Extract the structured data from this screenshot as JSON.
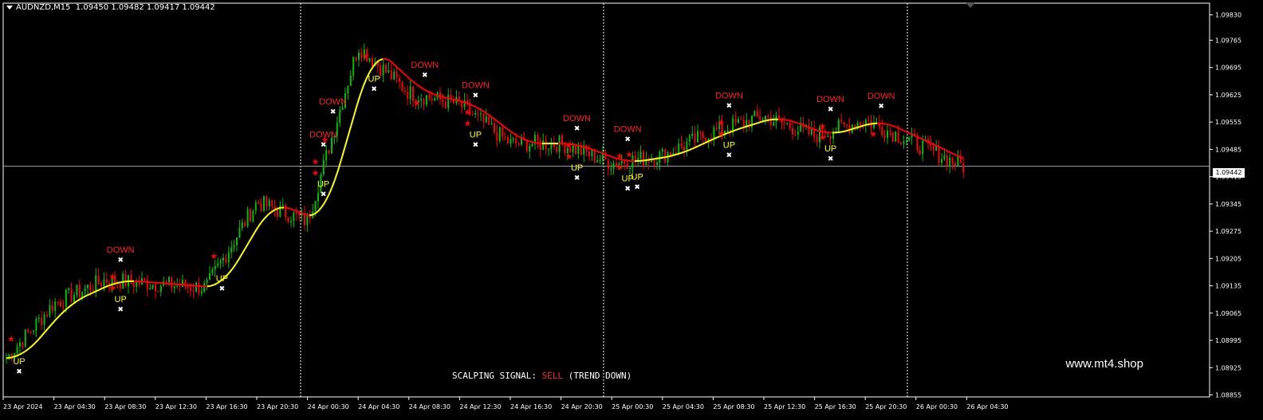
{
  "header": {
    "symbol_tf": "AUDNZD,M15",
    "ohlc": "1.09450 1.09482 1.09417 1.09442"
  },
  "watermark": "www.mt4.shop",
  "signal": {
    "prefix": "SCALPING SIGNAL: ",
    "value": "SELL",
    "suffix": " (TREND DOWN)",
    "value_color": "#ff2a2a"
  },
  "current_price": "1.09442",
  "colors": {
    "background": "#000000",
    "axis": "#ffffff",
    "bull_candle": "#00c000",
    "bear_candle": "#ff0000",
    "ma_up": "#ffff00",
    "ma_down": "#ff0000",
    "down_text": "#ff2020",
    "up_text": "#ffff00",
    "star": "#ff0000",
    "cross": "#ffffff"
  },
  "chart_data": {
    "type": "candlestick",
    "symbol": "AUDNZD",
    "timeframe": "M15",
    "y_ticks": [
      "1.09830",
      "1.09765",
      "1.09695",
      "1.09625",
      "1.09555",
      "1.09485",
      "1.09415",
      "1.09345",
      "1.09275",
      "1.09205",
      "1.09135",
      "1.09065",
      "1.08995",
      "1.08925",
      "1.08855"
    ],
    "ylim": [
      1.0885,
      1.0986
    ],
    "x_ticks": [
      "23 Apr 2024",
      "23 Apr 04:30",
      "23 Apr 08:30",
      "23 Apr 12:30",
      "23 Apr 16:30",
      "23 Apr 20:30",
      "24 Apr 00:30",
      "24 Apr 04:30",
      "24 Apr 08:30",
      "24 Apr 12:30",
      "24 Apr 16:30",
      "24 Apr 20:30",
      "25 Apr 00:30",
      "25 Apr 04:30",
      "25 Apr 08:30",
      "25 Apr 12:30",
      "25 Apr 16:30",
      "25 Apr 20:30",
      "26 Apr 00:30",
      "26 Apr 04:30"
    ],
    "day_separators": [
      "24 Apr 2024",
      "25 Apr 2024",
      "26 Apr 2024"
    ],
    "current_price": 1.09442,
    "close_path": [
      [
        "23 Apr 2024",
        1.0894
      ],
      [
        "23 Apr 04:30",
        1.0909
      ],
      [
        "23 Apr 08:30",
        1.0915
      ],
      [
        "23 Apr 12:30",
        1.0914
      ],
      [
        "23 Apr 16:30",
        1.0913
      ],
      [
        "23 Apr 20:30",
        1.0935
      ],
      [
        "24 Apr 00:30",
        1.093
      ],
      [
        "24 Apr 04:30",
        1.0975
      ],
      [
        "24 Apr 08:30",
        1.0963
      ],
      [
        "24 Apr 12:30",
        1.096
      ],
      [
        "24 Apr 16:30",
        1.095
      ],
      [
        "24 Apr 20:30",
        1.095
      ],
      [
        "25 Apr 00:30",
        1.0945
      ],
      [
        "25 Apr 04:30",
        1.0947
      ],
      [
        "25 Apr 08:30",
        1.0953
      ],
      [
        "25 Apr 12:30",
        1.0957
      ],
      [
        "25 Apr 16:30",
        1.0952
      ],
      [
        "25 Apr 20:30",
        1.0956
      ],
      [
        "26 Apr 00:30",
        1.095
      ],
      [
        "26 Apr 04:30",
        1.0944
      ]
    ],
    "signals": [
      {
        "label": "UP",
        "time": "23 Apr 2024"
      },
      {
        "label": "DOWN",
        "time": "23 Apr 08:30"
      },
      {
        "label": "UP",
        "time": "23 Apr 08:30"
      },
      {
        "label": "UP",
        "time": "23 Apr 16:30"
      },
      {
        "label": "DOWN",
        "time": "24 Apr 00:30"
      },
      {
        "label": "UP",
        "time": "24 Apr 00:30"
      },
      {
        "label": "DOWN",
        "time": "24 Apr 00:30"
      },
      {
        "label": "UP",
        "time": "24 Apr 04:30"
      },
      {
        "label": "DOWN",
        "time": "24 Apr 08:30"
      },
      {
        "label": "UP",
        "time": "24 Apr 12:30"
      },
      {
        "label": "DOWN",
        "time": "24 Apr 12:30"
      },
      {
        "label": "UP",
        "time": "24 Apr 20:30"
      },
      {
        "label": "DOWN",
        "time": "24 Apr 20:30"
      },
      {
        "label": "UP",
        "time": "25 Apr 00:30"
      },
      {
        "label": "UP",
        "time": "25 Apr 00:30"
      },
      {
        "label": "DOWN",
        "time": "25 Apr 00:30"
      },
      {
        "label": "DOWN",
        "time": "25 Apr 08:30"
      },
      {
        "label": "UP",
        "time": "25 Apr 08:30"
      },
      {
        "label": "DOWN",
        "time": "25 Apr 16:30"
      },
      {
        "label": "UP",
        "time": "25 Apr 16:30"
      },
      {
        "label": "DOWN",
        "time": "25 Apr 20:30"
      }
    ]
  }
}
